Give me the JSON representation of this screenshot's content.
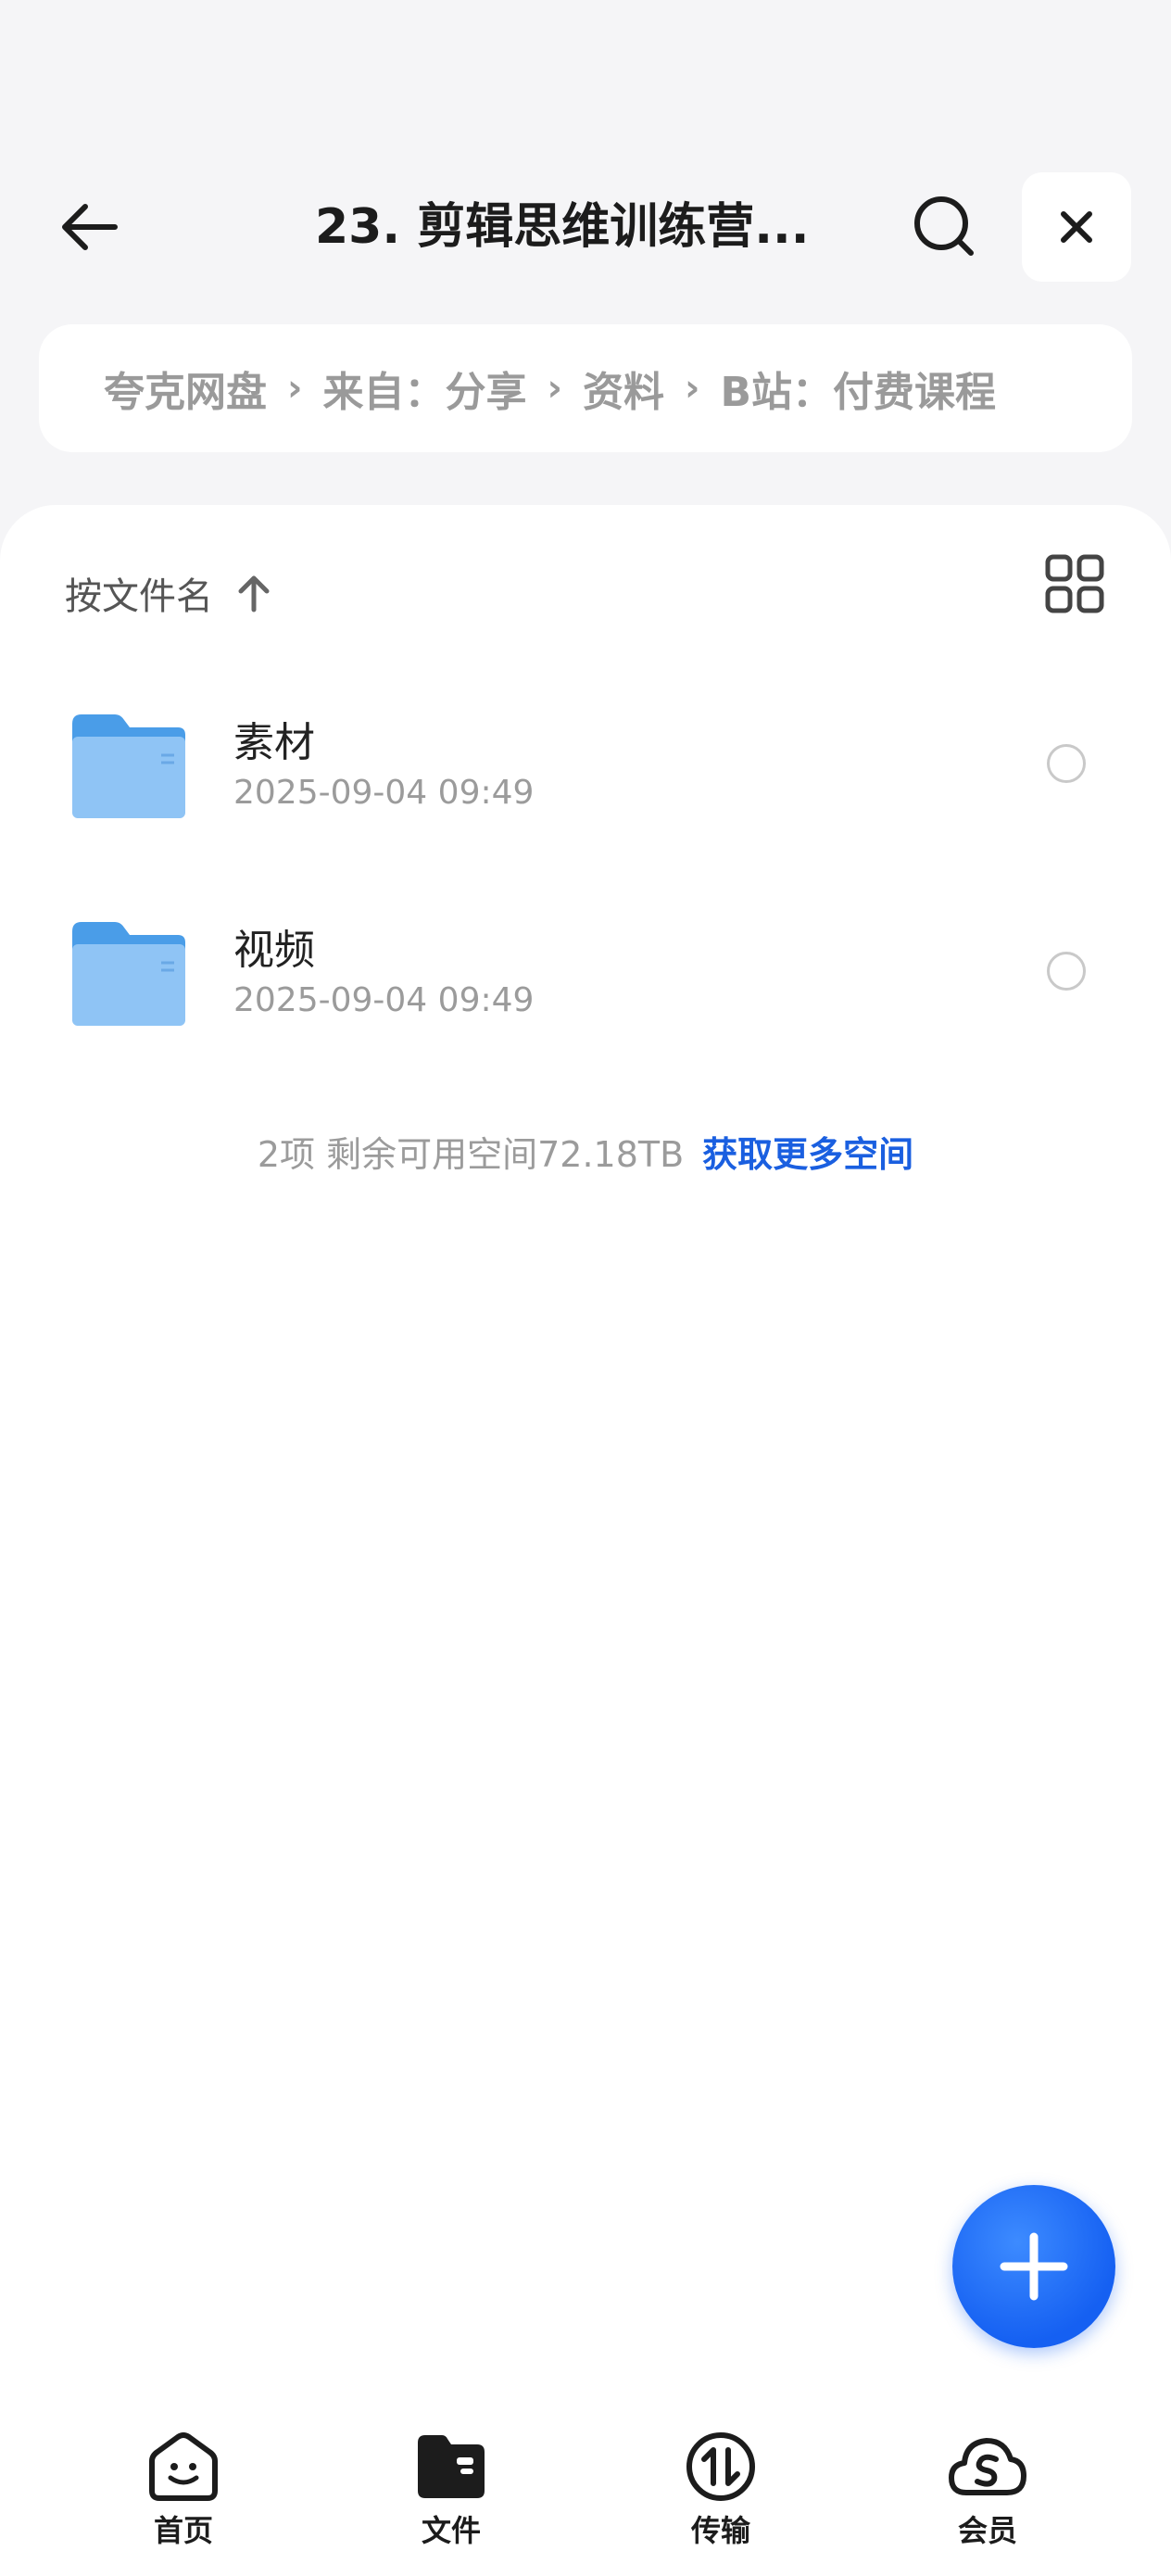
{
  "header": {
    "title": "23. 剪辑思维训练营...",
    "back_icon": "arrow-left-icon",
    "search_icon": "search-icon",
    "close_icon": "close-icon"
  },
  "breadcrumb": {
    "items": [
      "夸克网盘",
      "来自：分享",
      "资料",
      "B站：付费课程"
    ]
  },
  "sort": {
    "label": "按文件名",
    "direction_icon": "arrow-up-icon",
    "view_icon": "grid-view-icon"
  },
  "files": [
    {
      "name": "素材",
      "date": "2025-09-04 09:49"
    },
    {
      "name": "视频",
      "date": "2025-09-04 09:49"
    }
  ],
  "summary": {
    "text": "2项 剩余可用空间72.18TB",
    "link": "获取更多空间"
  },
  "nav": {
    "items": [
      {
        "label": "首页",
        "icon": "home-smile-icon"
      },
      {
        "label": "文件",
        "icon": "folder-icon"
      },
      {
        "label": "传输",
        "icon": "transfer-icon"
      },
      {
        "label": "会员",
        "icon": "cloud-member-icon"
      }
    ],
    "active": "文件"
  },
  "colors": {
    "accent": "#1a5fe0",
    "fab": "#1560f2",
    "folder": "#5aaaf0"
  }
}
